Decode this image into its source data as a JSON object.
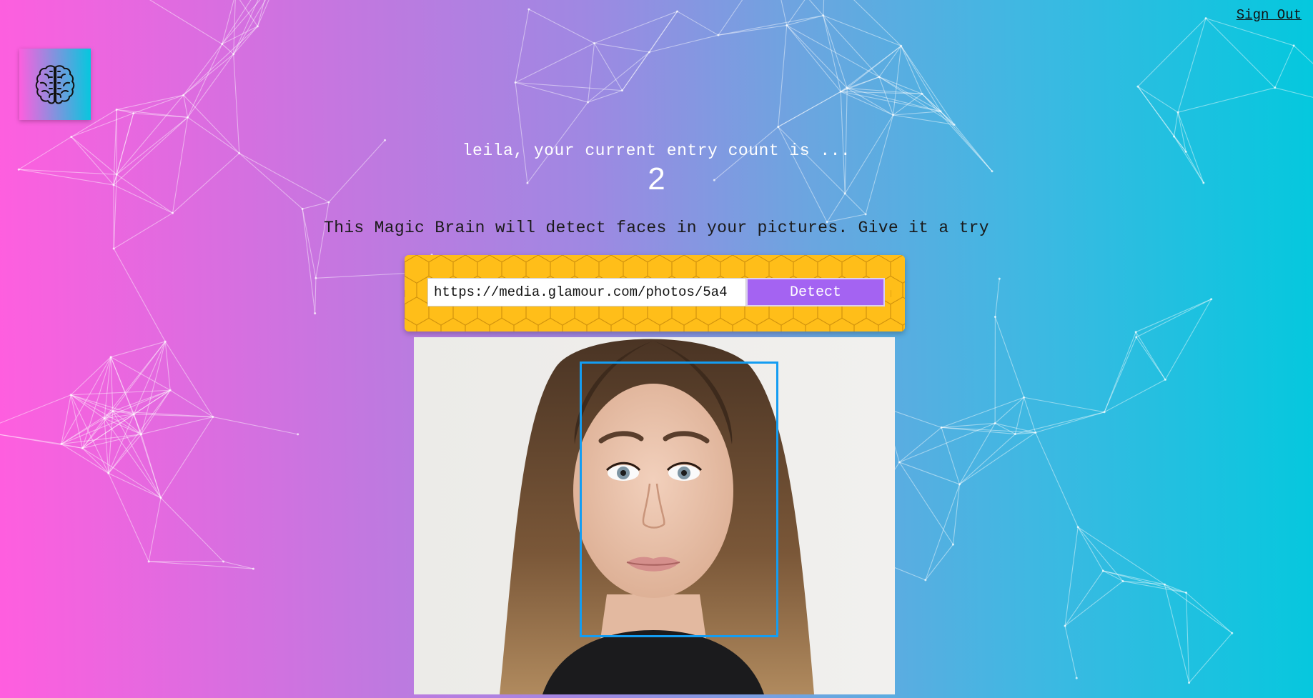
{
  "header": {
    "sign_out_label": "Sign Out",
    "logo_icon": "brain-icon"
  },
  "rank": {
    "greeting": "leila, your current entry count is ...",
    "entry_count": "2"
  },
  "intro": {
    "text": "This Magic Brain will detect faces in your pictures. Give it a try"
  },
  "form": {
    "url_value": "https://media.glamour.com/photos/5a4",
    "detect_label": "Detect"
  },
  "colors": {
    "gradient_start": "#ff5edf",
    "gradient_end": "#04c8de",
    "panel_yellow": "#ffbe19",
    "button_purple": "#a463f2",
    "bounding_box": "#149df2"
  }
}
